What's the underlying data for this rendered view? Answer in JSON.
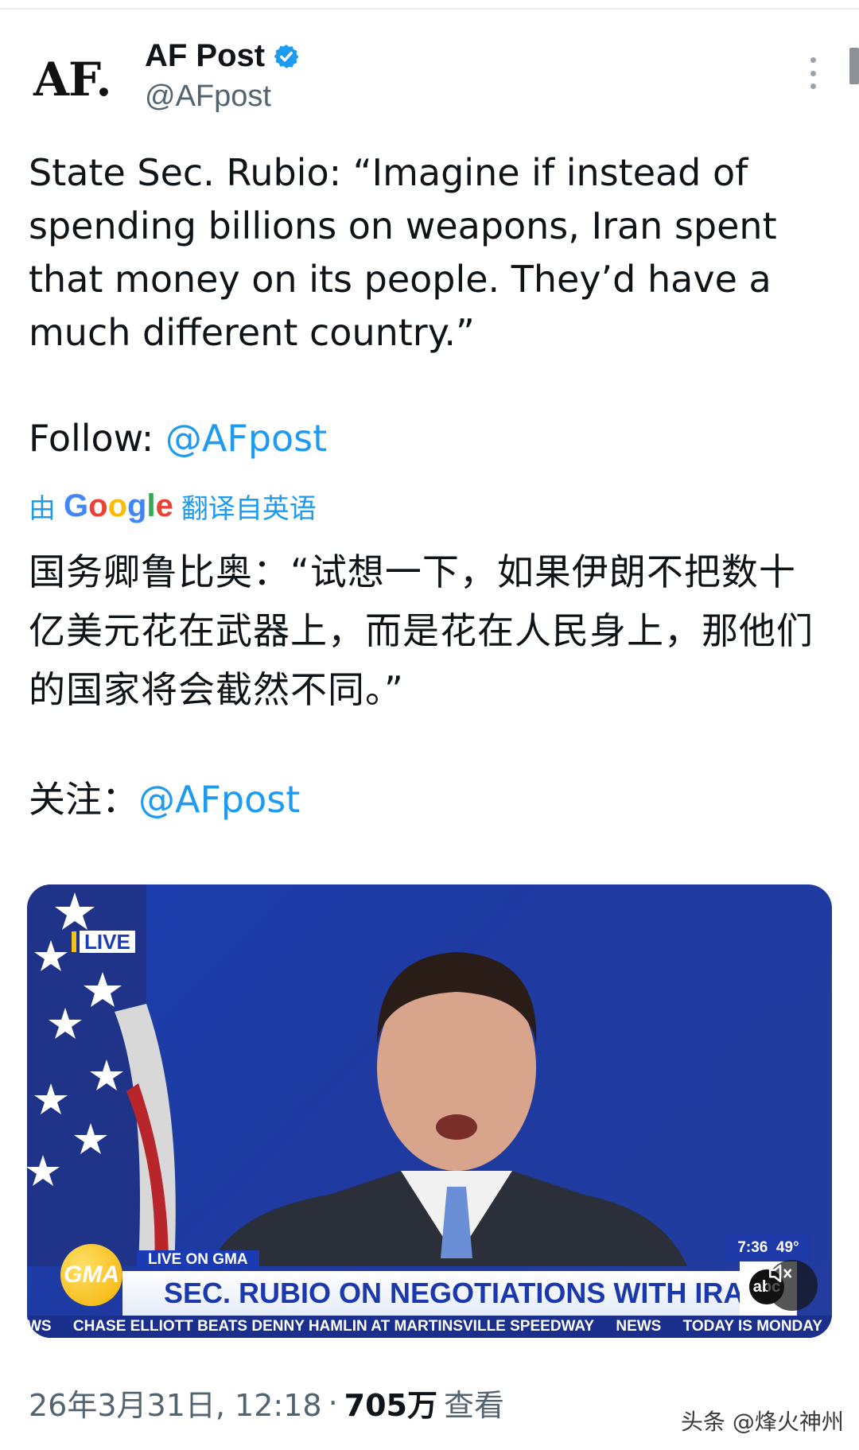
{
  "tweet": {
    "logo_text": "AF.",
    "display_name": "AF Post",
    "handle": "@AFpost",
    "text": "State Sec. Rubio: “Imagine if instead of spending billions on weapons, Iran spent that money on its people. They’d have a much different country.”",
    "follow_label": "Follow: ",
    "follow_handle": "@AFpost",
    "translation": {
      "prefix": "由",
      "brand": "Google",
      "suffix": "翻译自英语",
      "text": "国务卿鲁比奥：“试想一下，如果伊朗不把数十亿美元花在武器上，而是花在人民身上，那他们的国家将会截然不同。”",
      "follow_label": "关注：",
      "follow_handle": "@AFpost"
    },
    "media": {
      "live_badge": "LIVE",
      "live_on_label": "LIVE ON GMA",
      "gma_logo": "GMA",
      "headline": "SEC. RUBIO ON NEGOTIATIONS WITH IRAN",
      "time": "7:36",
      "temperature": "49°",
      "network_logo": "abc",
      "ticker": [
        "WS",
        "CHASE ELLIOTT BEATS DENNY HAMLIN AT MARTINSVILLE SPEEDWAY",
        "NEWS",
        "TODAY IS MONDAY"
      ],
      "mute_icon": "speaker-muted-icon"
    },
    "meta": {
      "date_time": "26年3月31日, 12:18",
      "separator": "·",
      "views_count": "705万",
      "views_label": "查看"
    }
  },
  "watermark": "头条 @烽火神州",
  "colors": {
    "link": "#1d9bf0",
    "verified": "#1d9bf0",
    "text": "#0f1419",
    "muted": "#536471"
  }
}
